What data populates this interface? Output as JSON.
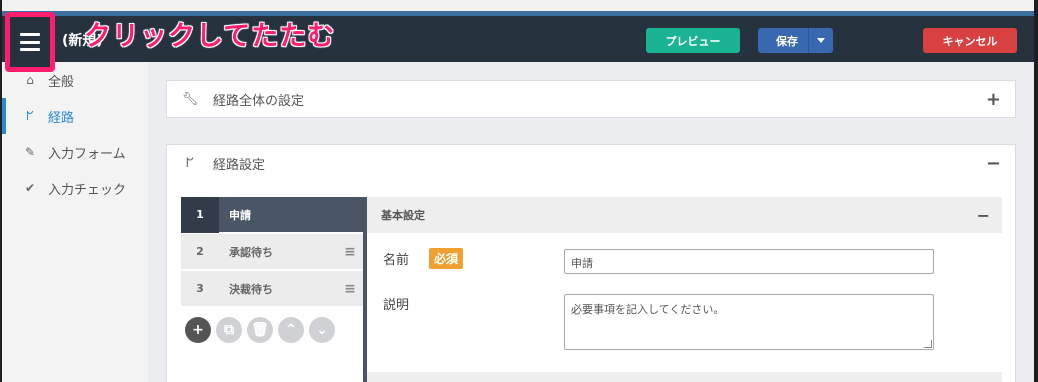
{
  "header": {
    "doc_title": "(新規)",
    "annotation": "クリックしてたたむ",
    "preview_label": "プレビュー",
    "save_label": "保存",
    "cancel_label": "キャンセル"
  },
  "sidebar": {
    "items": [
      {
        "label": "全般",
        "icon": "home-icon",
        "active": false
      },
      {
        "label": "経路",
        "icon": "route-icon",
        "active": true
      },
      {
        "label": "入力フォーム",
        "icon": "pencil-icon",
        "active": false
      },
      {
        "label": "入力チェック",
        "icon": "check-icon",
        "active": false
      }
    ]
  },
  "route_global": {
    "title": "経路全体の設定",
    "toggle": "+",
    "icon": "wrench-icon"
  },
  "route_settings": {
    "title": "経路設定",
    "toggle": "−",
    "icon": "route-icon"
  },
  "steps": [
    {
      "num": "1",
      "name": "申請",
      "active": true
    },
    {
      "num": "2",
      "name": "承認待ち",
      "active": false
    },
    {
      "num": "3",
      "name": "決裁待ち",
      "active": false
    }
  ],
  "step_tools": [
    "add-icon",
    "copy-icon",
    "delete-icon",
    "move-up-icon",
    "move-down-icon"
  ],
  "basic": {
    "title": "基本設定",
    "toggle": "−",
    "name_label": "名前",
    "required_badge": "必須",
    "name_value": "申請",
    "desc_label": "説明",
    "desc_placeholder": "必要事項を記入してください。"
  },
  "colors": {
    "navbar": "#27323f",
    "accent_highlight": "#ff1e6e",
    "preview": "#1ab394",
    "save": "#3868b0",
    "cancel": "#d94040",
    "active_link": "#2a8bd0",
    "badge": "#f0a030"
  }
}
